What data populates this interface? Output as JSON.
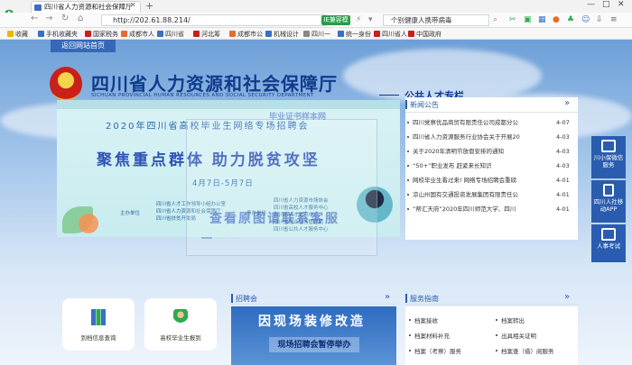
{
  "browser": {
    "tab_title": "四川省人力资源和社会保障厅",
    "url": "http://202.61.88.214/",
    "mode_label": "IE兼容模式",
    "search_text": "个别健康人携带病毒",
    "window_controls": [
      "—",
      "□",
      "✕"
    ],
    "bookmarks": [
      "收藏",
      "手机收藏夹",
      "国家税务",
      "成都市人",
      "四川省",
      "河北筹",
      "成都市公",
      "机械设计",
      "四川一",
      "统一身份",
      "四川省人",
      "中国政府"
    ]
  },
  "site": {
    "back_home": "返回网站首页",
    "title": "四川省人力资源和社会保障厅",
    "subtitle": "SICHUAN PROVINCIAL HUMAN RESOURCES AND SOCIAL SECURITY DEPARTMENT",
    "column_name": "公共人才专栏"
  },
  "banner": {
    "line1": "2020年四川省高校毕业生网络专场招聘会",
    "line2": "聚焦重点群体    助力脱贫攻坚",
    "line3": "4月7日-5月7日",
    "tags": [
      "四川省人才工作领导小组办公室",
      "主办单位",
      "四川省人力资源和社会保障厅",
      "四川省扶贫开发局",
      "承办单位",
      "四川省人力资源市场协会",
      "四川省高校人才服务中心",
      "四川省人才交流中心",
      "四川省就业服务管理局",
      "四川省公共人才服务中心"
    ]
  },
  "watermark": {
    "small": "毕业证书样本网",
    "big": "查看原图请联系客服"
  },
  "news": {
    "title": "新闻公告",
    "more": "»",
    "items": [
      {
        "text": "四川党察优品商贸有限责任公司成都分公",
        "date": "4-07"
      },
      {
        "text": "四川省人力资源服务行业协会关于开展20",
        "date": "4-03"
      },
      {
        "text": "关于2020年清明节放假安排的通知",
        "date": "4-03"
      },
      {
        "text": "“50+”职业发布 赶紧来长知识",
        "date": "4-03"
      },
      {
        "text": "网校毕业生看过来! 网络专场招聘会重磅",
        "date": "4-01"
      },
      {
        "text": "凉山州国有交通投资发展集团有限责任公",
        "date": "4-01"
      },
      {
        "text": "“帮汇天府”2020年四川师范大学、四川",
        "date": "4-01"
      }
    ]
  },
  "side": [
    {
      "label": "川小保微信服务"
    },
    {
      "label": "四川人社移动APP"
    },
    {
      "label": "人事考试"
    }
  ],
  "services": [
    {
      "label": "到档信息查询"
    },
    {
      "label": "高校毕业生报到"
    }
  ],
  "recruit": {
    "title": "招聘会",
    "more": "»",
    "img_top": "因现场装修改造",
    "img_bottom": "现场招聘会暂停举办"
  },
  "guide": {
    "title": "服务指南",
    "more": "»",
    "items": [
      "档案接收",
      "档案转出",
      "档案材料补充",
      "出具相关证明",
      "档案（考察）服务",
      "档案查（借）阅服务"
    ]
  }
}
